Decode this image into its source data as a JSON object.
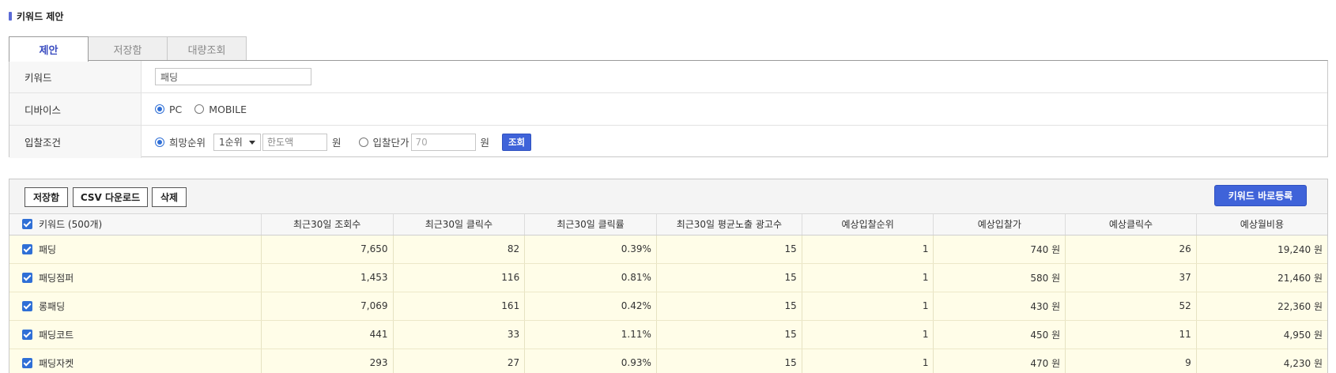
{
  "page": {
    "title": "키워드 제안"
  },
  "tabs": [
    {
      "label": "제안",
      "active": true
    },
    {
      "label": "저장함",
      "active": false
    },
    {
      "label": "대량조회",
      "active": false
    }
  ],
  "form": {
    "keyword": {
      "label": "키워드",
      "value": "패딩"
    },
    "device": {
      "label": "디바이스",
      "options": [
        "PC",
        "MOBILE"
      ],
      "selected": "PC"
    },
    "bid": {
      "label": "입찰조건",
      "option_rank": "희망순위",
      "rank_select": "1순위",
      "rank_amount_placeholder": "한도액",
      "unit": "원",
      "option_price": "입찰단가",
      "price_placeholder": "70",
      "search_button": "조회"
    }
  },
  "toolbar": {
    "save": "저장함",
    "csv": "CSV 다운로드",
    "delete": "삭제",
    "register": "키워드 바로등록"
  },
  "table": {
    "headers": [
      "키워드 (500개)",
      "최근30일 조회수",
      "최근30일 클릭수",
      "최근30일 클릭률",
      "최근30일 평균노출 광고수",
      "예상입찰순위",
      "예상입찰가",
      "예상클릭수",
      "예상월비용"
    ],
    "rows": [
      [
        "패딩",
        "7,650",
        "82",
        "0.39%",
        "15",
        "1",
        "740 원",
        "26",
        "19,240 원"
      ],
      [
        "패딩점퍼",
        "1,453",
        "116",
        "0.81%",
        "15",
        "1",
        "580 원",
        "37",
        "21,460 원"
      ],
      [
        "롱패딩",
        "7,069",
        "161",
        "0.42%",
        "15",
        "1",
        "430 원",
        "52",
        "22,360 원"
      ],
      [
        "패딩코트",
        "441",
        "33",
        "1.11%",
        "15",
        "1",
        "450 원",
        "11",
        "4,950 원"
      ],
      [
        "패딩자켓",
        "293",
        "27",
        "0.93%",
        "15",
        "1",
        "470 원",
        "9",
        "4,230 원"
      ]
    ]
  },
  "colors": {
    "accent": "#3f63d9",
    "row_highlight": "#fffde8"
  },
  "icons": {
    "checkbox": "checkbox-checked-icon",
    "caret": "caret-down-icon"
  }
}
